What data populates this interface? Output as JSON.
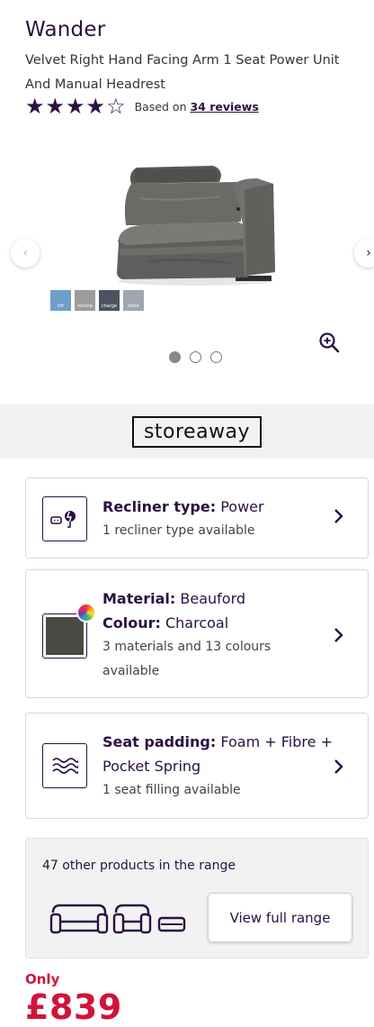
{
  "product": {
    "brand": "Wander",
    "name": "Velvet Right Hand Facing Arm 1 Seat Power Unit And Manual Headrest",
    "rating": 4,
    "rating_max": 5,
    "reviews_prefix": "Based on",
    "reviews_link": "34 reviews"
  },
  "gallery": {
    "thumbnail_labels": [
      "tilt",
      "recline",
      "charge",
      "store"
    ],
    "thumbnail_colors": [
      "#6f9ec9",
      "#9c9c9c",
      "#4b5363",
      "#9fa6b2"
    ],
    "slide_count": 3,
    "active_slide": 1,
    "left_arrow": "‹",
    "right_arrow": "›",
    "zoom_icon": "zoom-in-icon"
  },
  "storeaway": {
    "logo_text": "storeaway"
  },
  "options": [
    {
      "title_label": "Recliner type:",
      "title_value": "Power",
      "line2_label": "",
      "line2_value": "",
      "sub": "1 recliner type available",
      "icon": "power-plug-icon"
    },
    {
      "title_label": "Material:",
      "title_value": "Beauford",
      "line2_label": "Colour:",
      "line2_value": "Charcoal",
      "sub": "3 materials and 13 colours available",
      "icon": "fabric-swatch",
      "swatch_color": "#4a4a47"
    },
    {
      "title_label": "Seat padding:",
      "title_value": "Foam + Fibre + Pocket Spring",
      "line2_label": "",
      "line2_value": "",
      "sub": "1 seat filling available",
      "icon": "waves-icon"
    }
  ],
  "range": {
    "text": "47 other products in the range",
    "button_label": "View full range"
  },
  "price": {
    "prefix": "Only",
    "amount": "£839"
  },
  "colors": {
    "brand_purple": "#2b1142",
    "price_red": "#d0143c",
    "band_gray": "#f2f2f2"
  }
}
